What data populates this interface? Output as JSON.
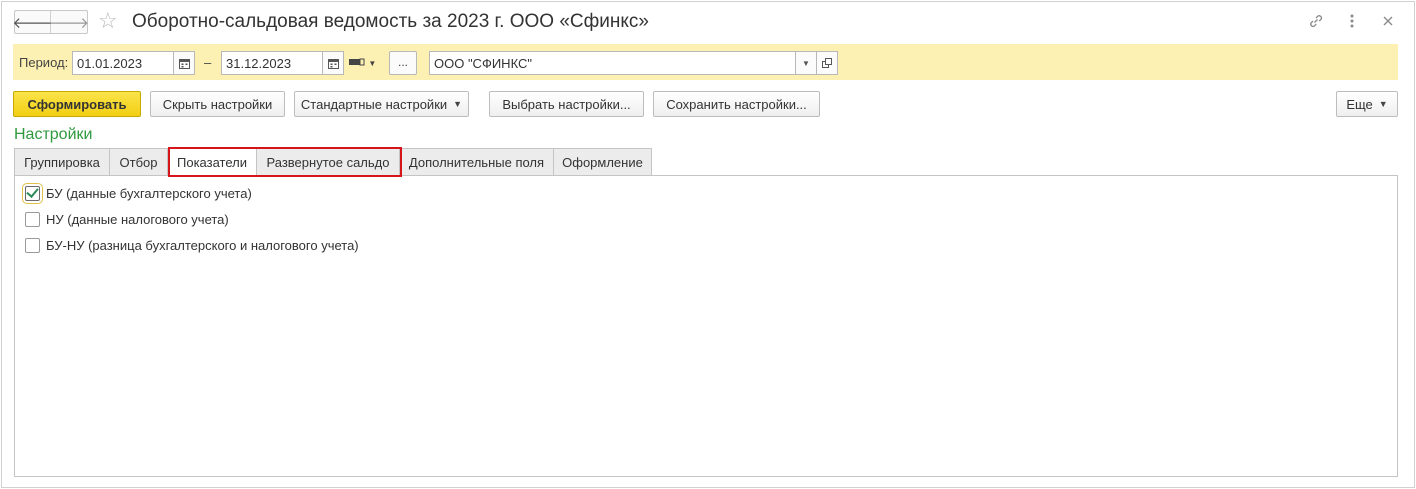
{
  "window": {
    "title": "Оборотно-сальдовая ведомость за 2023 г. ООО «Сфинкс»",
    "icons": [
      "arrow-left-icon",
      "arrow-right-icon",
      "star-icon",
      "link-icon",
      "more-vertical-icon",
      "close-icon"
    ]
  },
  "period": {
    "label": "Период:",
    "start": "01.01.2023",
    "dash": "–",
    "end": "31.12.2023",
    "select_button": "...",
    "organization": "ООО \"СФИНКС\""
  },
  "toolbar": {
    "generate": "Сформировать",
    "hide_settings": "Скрыть настройки",
    "standard_settings": "Стандартные настройки",
    "choose_settings": "Выбрать настройки...",
    "save_settings": "Сохранить настройки...",
    "more": "Еще"
  },
  "settings": {
    "heading": "Настройки",
    "tabs": [
      {
        "label": "Группировка"
      },
      {
        "label": "Отбор"
      },
      {
        "label": "Показатели"
      },
      {
        "label": "Развернутое сальдо"
      },
      {
        "label": "Дополнительные поля"
      },
      {
        "label": "Оформление"
      }
    ],
    "active_tab": "Показатели",
    "indicators": [
      {
        "label": "БУ (данные бухгалтерского учета)",
        "checked": true
      },
      {
        "label": "НУ (данные налогового учета)",
        "checked": false
      },
      {
        "label": "БУ-НУ (разница бухгалтерского и налогового учета)",
        "checked": false
      }
    ]
  },
  "colors": {
    "accent_yellow": "#f2cf13",
    "period_bar": "#fcf0b2",
    "heading_green": "#2f9a3e",
    "highlight_red": "#d8141b"
  }
}
